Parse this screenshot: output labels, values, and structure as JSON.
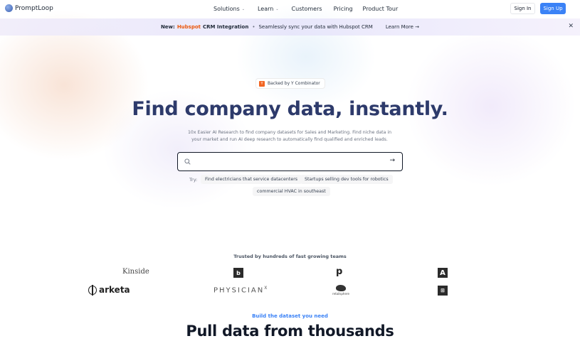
{
  "brand": {
    "name": "PromptLoop",
    "logo_icon": "promptloop-logo-icon",
    "accent": "#3b82f6"
  },
  "nav": {
    "items": [
      {
        "label": "Solutions",
        "dropdown": true
      },
      {
        "label": "Learn",
        "dropdown": true
      },
      {
        "label": "Customers",
        "dropdown": false
      },
      {
        "label": "Pricing",
        "dropdown": false
      },
      {
        "label": "Product Tour",
        "dropdown": false
      }
    ],
    "sign_in": "Sign In",
    "sign_up": "Sign Up"
  },
  "banner": {
    "new": "New:",
    "hubspot": "Hubspot",
    "integration": "CRM Integration",
    "separator": "•",
    "message": "Seamlessly sync your data with Hubspot CRM",
    "learn_more": "Learn More →",
    "close": "✕"
  },
  "hero": {
    "badge_mark": "Y",
    "badge_text": "Backed by Y Combinator",
    "headline": "Find company data, instantly.",
    "subtitle": "10x Easier AI Research to find company datasets for Sales and Marketing. Find niche data in your market and run AI deep research to automatically find qualified and enriched leads.",
    "search": {
      "value": "",
      "placeholder": "",
      "go": "→"
    },
    "try_label": "Try:",
    "suggestions": [
      "Find electricians that service datacenters",
      "Startups selling dev tools for robotics",
      "commercial HVAC in southeast"
    ]
  },
  "trusted": {
    "label": "Trusted by hundreds of fast growing teams",
    "logos": {
      "kinside": "Kinside",
      "b": "b",
      "p": "p",
      "a": "A",
      "arketa": "arketa",
      "physician": "PHYSICIAN",
      "physician_sup": "X",
      "retail": "retailsphere",
      "tile": "⊞"
    }
  },
  "section": {
    "label": "Build the dataset you need",
    "title": "Pull data from thousands"
  }
}
